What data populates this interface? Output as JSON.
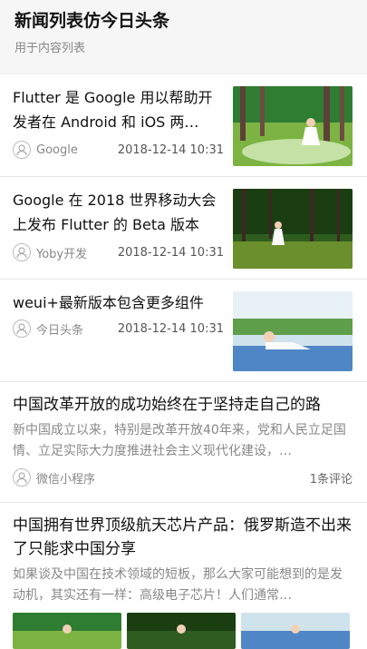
{
  "header": {
    "title": "新闻列表仿今日头条",
    "subtitle": "用于内容列表"
  },
  "news": [
    {
      "title": "Flutter 是 Google 用以帮助开发者在 Android 和 iOS 两…",
      "source": "Google",
      "time": "2018-12-14 10:31",
      "image": "park-girl-tree-icon"
    },
    {
      "title": "Google 在 2018 世界移动大会上发布 Flutter 的 Beta 版本",
      "source": "Yoby开发",
      "time": "2018-12-14 10:31",
      "image": "forest-girl-icon"
    },
    {
      "title": "weui+最新版本包含更多组件",
      "source": "今日头条",
      "time": "2018-12-14 10:31",
      "image": "table-girl-icon"
    },
    {
      "title": "中国改革开放的成功始终在于坚持走自己的路",
      "summary": "新中国成立以来，特别是改革开放40年来，党和人民立足国情、立足实际大力度推进社会主义现代化建设，…",
      "source": "微信小程序",
      "comments": "1条评论"
    },
    {
      "title": "中国拥有世界顶级航天芯片产品：俄罗斯造不出来了只能求中国分享",
      "summary": "如果谈及中国在技术领域的短板，那么大家可能想到的是发动机，其实还有一样：高级电子芯片！人们通常…",
      "images": [
        "park-girl-tree-icon",
        "forest-girl-icon",
        "table-girl-icon"
      ]
    }
  ]
}
